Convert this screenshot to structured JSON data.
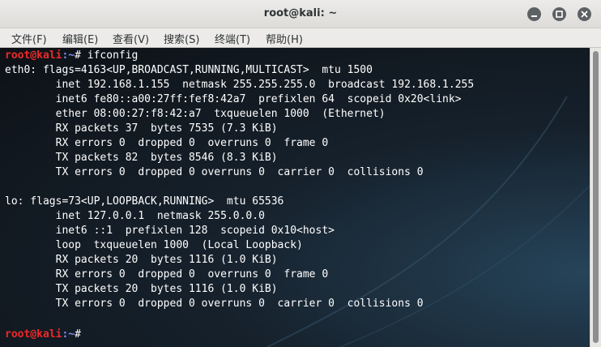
{
  "window": {
    "title": "root@kali: ~"
  },
  "menu": [
    {
      "label": "文件(F)"
    },
    {
      "label": "编辑(E)"
    },
    {
      "label": "查看(V)"
    },
    {
      "label": "搜索(S)"
    },
    {
      "label": "终端(T)"
    },
    {
      "label": "帮助(H)"
    }
  ],
  "prompt": {
    "user": "root@kali",
    "path": ":~",
    "symbol": "# "
  },
  "terminal": {
    "command": "ifconfig",
    "output": [
      "eth0: flags=4163<UP,BROADCAST,RUNNING,MULTICAST>  mtu 1500",
      "        inet 192.168.1.155  netmask 255.255.255.0  broadcast 192.168.1.255",
      "        inet6 fe80::a00:27ff:fef8:42a7  prefixlen 64  scopeid 0x20<link>",
      "        ether 08:00:27:f8:42:a7  txqueuelen 1000  (Ethernet)",
      "        RX packets 37  bytes 7535 (7.3 KiB)",
      "        RX errors 0  dropped 0  overruns 0  frame 0",
      "        TX packets 82  bytes 8546 (8.3 KiB)",
      "        TX errors 0  dropped 0 overruns 0  carrier 0  collisions 0",
      "",
      "lo: flags=73<UP,LOOPBACK,RUNNING>  mtu 65536",
      "        inet 127.0.0.1  netmask 255.0.0.0",
      "        inet6 ::1  prefixlen 128  scopeid 0x10<host>",
      "        loop  txqueuelen 1000  (Local Loopback)",
      "        RX packets 20  bytes 1116 (1.0 KiB)",
      "        RX errors 0  dropped 0  overruns 0  frame 0",
      "        TX packets 20  bytes 1116 (1.0 KiB)",
      "        TX errors 0  dropped 0 overruns 0  carrier 0  collisions 0",
      ""
    ]
  },
  "icons": {
    "minimize": "minimize-icon",
    "maximize": "maximize-icon",
    "close": "close-icon"
  },
  "colors": {
    "prompt_user": "#ef2929",
    "prompt_path": "#7f8fff",
    "terminal_text": "#ffffff"
  }
}
